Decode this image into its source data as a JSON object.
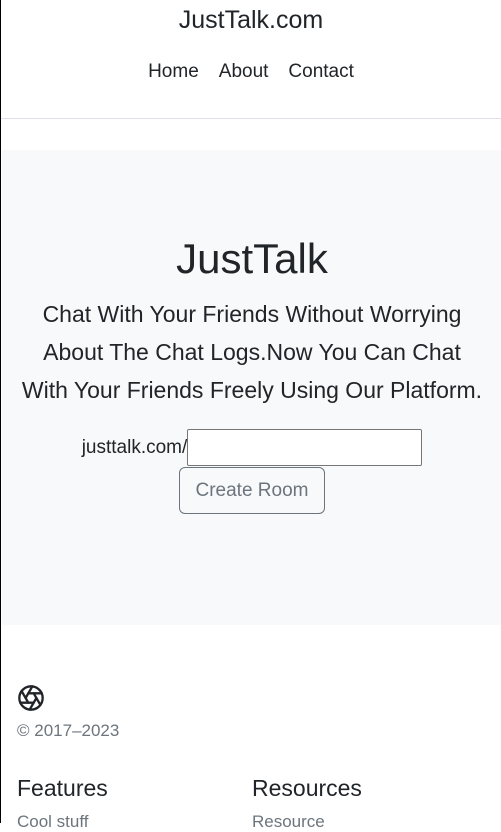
{
  "header": {
    "brand": "JustTalk.com",
    "nav": [
      "Home",
      "About",
      "Contact"
    ]
  },
  "hero": {
    "title": "JustTalk",
    "text": "Chat With Your Friends Without Worrying About The Chat Logs.Now You Can Chat With Your Friends Freely Using Our Platform.",
    "prefix": "justtalk.com/",
    "input_value": "",
    "button_label": "Create Room"
  },
  "footer": {
    "logo_icon": "aperture-icon",
    "copyright": "© 2017–2023",
    "columns": [
      {
        "heading": "Features",
        "links": [
          "Cool stuff"
        ]
      },
      {
        "heading": "Resources",
        "links": [
          "Resource"
        ]
      }
    ]
  },
  "colors": {
    "hero_bg": "#f8f9fa",
    "muted": "#6c757d",
    "text": "#212529"
  }
}
